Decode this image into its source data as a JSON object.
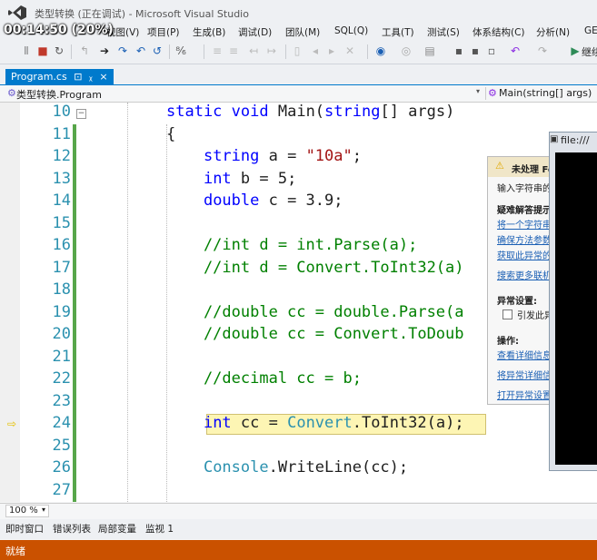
{
  "window": {
    "title": "类型转换 (正在调试) - Microsoft Visual Studio",
    "overlay_timer": "00:14:50 (20%)"
  },
  "menu": [
    "视图(V)",
    "项目(P)",
    "生成(B)",
    "调试(D)",
    "团队(M)",
    "SQL(Q)",
    "工具(T)",
    "测试(S)",
    "体系结构(C)",
    "分析(N)",
    "GE"
  ],
  "toolbar": {
    "continue_label": "继续"
  },
  "tab": {
    "label": "Program.cs",
    "pin": "⊡",
    "modified": "ᵪ",
    "close": "×"
  },
  "navbar": {
    "left": "类型转换.Program",
    "right": "Main(string[] args)"
  },
  "code": [
    {
      "num": "10",
      "text": "static void Main(string[] args)"
    },
    {
      "num": "11",
      "text": "{"
    },
    {
      "num": "12",
      "text": "    string a = \"10a\";"
    },
    {
      "num": "13",
      "text": "    int b = 5;"
    },
    {
      "num": "14",
      "text": "    double c = 3.9;"
    },
    {
      "num": "15",
      "text": ""
    },
    {
      "num": "16",
      "text": "    //int d = int.Parse(a);"
    },
    {
      "num": "17",
      "text": "    //int d = Convert.ToInt32(a)"
    },
    {
      "num": "18",
      "text": ""
    },
    {
      "num": "19",
      "text": "    //double cc = double.Parse(a"
    },
    {
      "num": "20",
      "text": "    //double cc = Convert.ToDoub"
    },
    {
      "num": "21",
      "text": ""
    },
    {
      "num": "22",
      "text": "    //decimal cc = b;"
    },
    {
      "num": "23",
      "text": ""
    },
    {
      "num": "24",
      "text": "    int cc = Convert.ToInt32(a);"
    },
    {
      "num": "25",
      "text": ""
    },
    {
      "num": "26",
      "text": "    Console.WriteLine(cc);"
    },
    {
      "num": "27",
      "text": ""
    }
  ],
  "exception": {
    "title": "未处理 Fo",
    "line1": "输入字符串的",
    "tips_header": "疑难解答提示",
    "tip1": "将一个字符串",
    "tip2": "确保方法参数",
    "tip3": "获取此异常的",
    "more": "搜索更多联机",
    "settings_header": "异常设置:",
    "checkbox_label": "引发此异",
    "actions_header": "操作:",
    "action1": "查看详细信息",
    "action2": "将异常详细信",
    "action3": "打开异常设置"
  },
  "console": {
    "title": "file:///"
  },
  "zoom": "100 %",
  "bottom_tabs": [
    "即时窗口",
    "错误列表",
    "局部变量",
    "监视 1"
  ],
  "status": "就绪",
  "colors": {
    "accent": "#007acc",
    "status_bar": "#ca5100",
    "keyword": "#0000ff",
    "string": "#a31515",
    "comment": "#008000",
    "line_number": "#2b91af"
  }
}
